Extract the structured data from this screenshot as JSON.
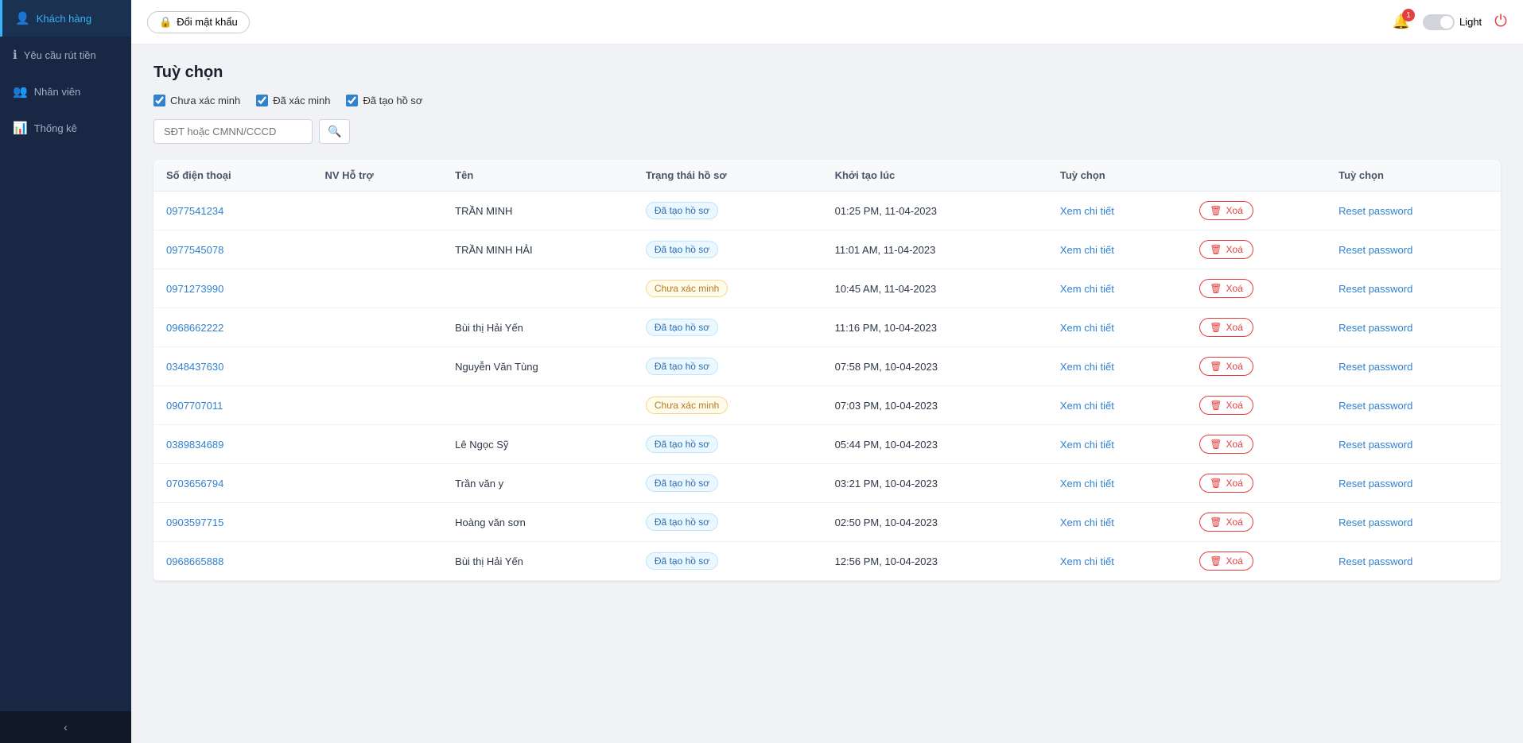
{
  "topbar": {
    "change_pw_label": "Đổi mật khẩu",
    "notif_count": "1",
    "theme_label": "Light",
    "power_icon": "⏻"
  },
  "sidebar": {
    "items": [
      {
        "id": "khach-hang",
        "label": "Khách hàng",
        "icon": "👤",
        "active": true
      },
      {
        "id": "yeu-cau-rut-tien",
        "label": "Yêu cầu rút tiền",
        "icon": "ℹ",
        "active": false
      },
      {
        "id": "nhan-vien",
        "label": "Nhân viên",
        "icon": "👥",
        "active": false
      },
      {
        "id": "thong-ke",
        "label": "Thống kê",
        "icon": "📊",
        "active": false
      }
    ],
    "collapse_label": "‹"
  },
  "page": {
    "title": "Tuỳ chọn",
    "filters": [
      {
        "id": "chua-xac-minh",
        "label": "Chưa xác minh",
        "checked": true
      },
      {
        "id": "da-xac-minh",
        "label": "Đã xác minh",
        "checked": true
      },
      {
        "id": "da-tao-ho-so",
        "label": "Đã tạo hồ sơ",
        "checked": true
      }
    ],
    "search": {
      "placeholder": "SĐT hoặc CMNN/CCCD",
      "button_icon": "🔍"
    },
    "table": {
      "columns": [
        "Số điện thoại",
        "NV Hỗ trợ",
        "Tên",
        "Trạng thái hồ sơ",
        "Khởi tạo lúc",
        "Tuỳ chọn",
        "",
        "Tuỳ chọn"
      ],
      "rows": [
        {
          "phone": "0977541234",
          "nv": "",
          "name": "TRẦN MINH",
          "status": "Đã tạo hồ sơ",
          "status_type": "created",
          "time": "01:25 PM, 11-04-2023"
        },
        {
          "phone": "0977545078",
          "nv": "",
          "name": "TRẦN MINH HẢI",
          "status": "Đã tạo hồ sơ",
          "status_type": "created",
          "time": "11:01 AM, 11-04-2023"
        },
        {
          "phone": "0971273990",
          "nv": "",
          "name": "",
          "status": "Chưa xác minh",
          "status_type": "unverified",
          "time": "10:45 AM, 11-04-2023"
        },
        {
          "phone": "0968662222",
          "nv": "",
          "name": "Bùi thị Hải Yến",
          "status": "Đã tạo hồ sơ",
          "status_type": "created",
          "time": "11:16 PM, 10-04-2023"
        },
        {
          "phone": "0348437630",
          "nv": "",
          "name": "Nguyễn Văn Tùng",
          "status": "Đã tạo hồ sơ",
          "status_type": "created",
          "time": "07:58 PM, 10-04-2023"
        },
        {
          "phone": "0907707011",
          "nv": "",
          "name": "",
          "status": "Chưa xác minh",
          "status_type": "unverified",
          "time": "07:03 PM, 10-04-2023"
        },
        {
          "phone": "0389834689",
          "nv": "",
          "name": "Lê Ngọc Sỹ",
          "status": "Đã tạo hồ sơ",
          "status_type": "created",
          "time": "05:44 PM, 10-04-2023"
        },
        {
          "phone": "0703656794",
          "nv": "",
          "name": "Trần văn y",
          "status": "Đã tạo hồ sơ",
          "status_type": "created",
          "time": "03:21 PM, 10-04-2023"
        },
        {
          "phone": "0903597715",
          "nv": "",
          "name": "Hoàng văn sơn",
          "status": "Đã tạo hồ sơ",
          "status_type": "created",
          "time": "02:50 PM, 10-04-2023"
        },
        {
          "phone": "0968665888",
          "nv": "",
          "name": "Bùi thị Hải Yến",
          "status": "Đã tạo hồ sơ",
          "status_type": "created",
          "time": "12:56 PM, 10-04-2023"
        }
      ],
      "actions": {
        "view": "Xem chi tiết",
        "delete": "Xoá",
        "reset": "Reset password"
      }
    }
  }
}
